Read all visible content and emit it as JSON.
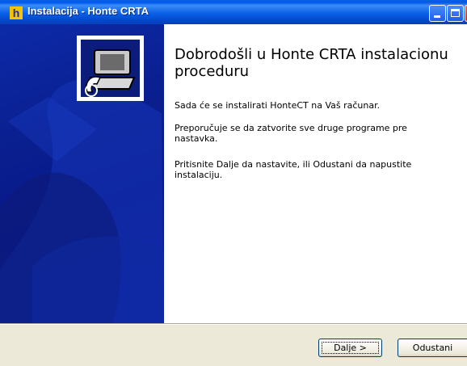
{
  "window": {
    "title": "Instalacija - Honte CRTA",
    "app_icon_letter": "h"
  },
  "welcome": {
    "heading": "Dobrodošli u Honte CRTA instalacionu proceduru",
    "paragraph1": "Sada će se instalirati HonteCT na Vaš računar.",
    "paragraph2": "Preporučuje se da zatvorite sve druge programe pre nastavka.",
    "paragraph3": "Pritisnite Dalje da nastavite, ili Odustani da napustite instalaciju."
  },
  "buttons": {
    "next_label": "Dalje >",
    "cancel_label": "Odustani"
  },
  "colors": {
    "titlebar": "#0a5fe2",
    "banner": "#0a1f8f",
    "dialog_bg": "#ece9d8"
  }
}
